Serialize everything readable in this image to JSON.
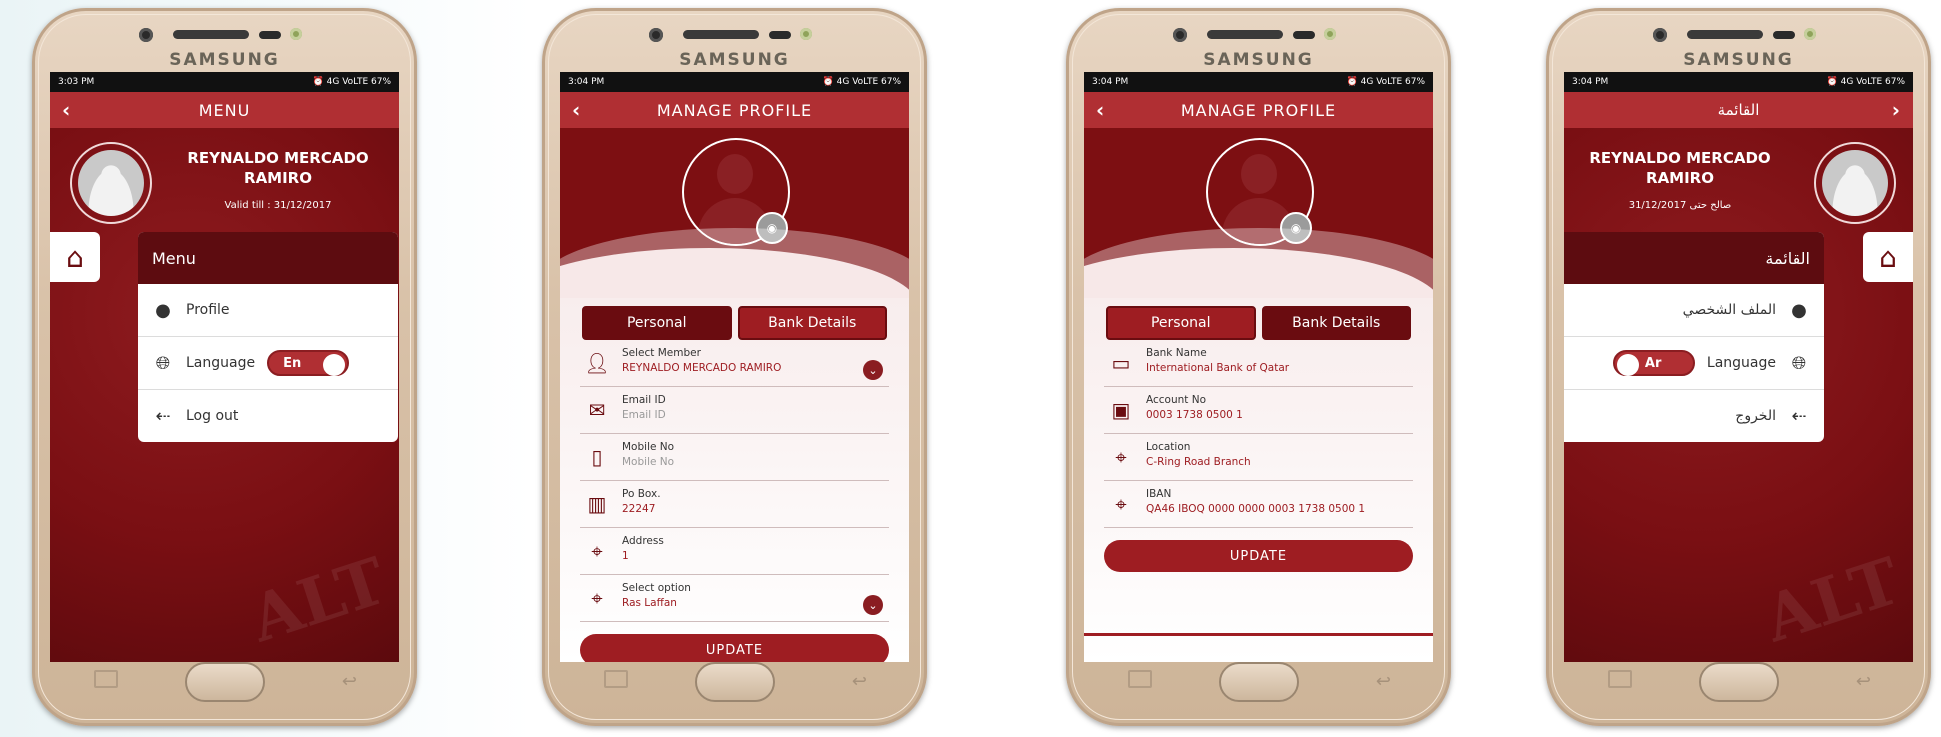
{
  "brand": "SAMSUNG",
  "phone1": {
    "status": {
      "time": "3:03 PM",
      "icons": "⏰ 4G VoLTE 67%"
    },
    "title": "MENU",
    "user": {
      "name_line1": "REYNALDO MERCADO",
      "name_line2": "RAMIRO",
      "valid": "Valid till : 31/12/2017"
    },
    "menu": {
      "header": "Menu",
      "items": [
        {
          "label": "Profile"
        },
        {
          "label": "Language"
        },
        {
          "label": "Log out"
        }
      ],
      "toggle": "En"
    }
  },
  "phone2": {
    "status": {
      "time": "3:04 PM",
      "icons": "⏰ 4G VoLTE 67%"
    },
    "title": "MANAGE PROFILE",
    "tabs": [
      "Personal",
      "Bank Details"
    ],
    "fields": [
      {
        "label": "Select Member",
        "value": "REYNALDO MERCADO RAMIRO"
      },
      {
        "label": "Email ID",
        "value": "Email ID"
      },
      {
        "label": "Mobile No",
        "value": "Mobile No"
      },
      {
        "label": "Po Box.",
        "value": "22247"
      },
      {
        "label": "Address",
        "value": "1"
      },
      {
        "label": "Select option",
        "value": "Ras Laffan"
      }
    ],
    "update": "UPDATE"
  },
  "phone3": {
    "status": {
      "time": "3:04 PM",
      "icons": "⏰ 4G VoLTE 67%"
    },
    "title": "MANAGE PROFILE",
    "tabs": [
      "Personal",
      "Bank Details"
    ],
    "fields": [
      {
        "label": "Bank Name",
        "value": "International Bank of Qatar"
      },
      {
        "label": "Account No",
        "value": "0003 1738 0500 1"
      },
      {
        "label": "Location",
        "value": "C-Ring Road Branch"
      },
      {
        "label": "IBAN",
        "value": "QA46 IBOQ 0000 0000 0003 1738 0500 1"
      }
    ],
    "update": "UPDATE"
  },
  "phone4": {
    "status": {
      "time": "3:04 PM",
      "icons": "⏰ 4G VoLTE 67%"
    },
    "title": "القائمة",
    "user": {
      "name_line1": "REYNALDO MERCADO",
      "name_line2": "RAMIRO",
      "valid": "31/12/2017 صالح حتى"
    },
    "menu": {
      "header": "القائمة",
      "items": [
        {
          "label": "الملف الشخصي"
        },
        {
          "label": "Language"
        },
        {
          "label": "الخروج"
        }
      ],
      "toggle": "Ar"
    }
  },
  "colors": {
    "primary": "#7d0f12",
    "titlebar": "#b02f33",
    "accent": "#9e1d22"
  }
}
